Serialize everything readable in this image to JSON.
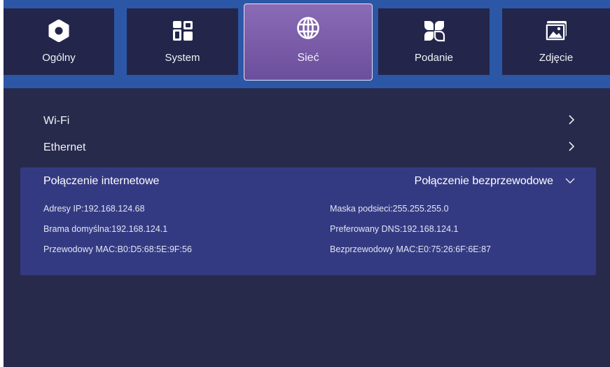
{
  "tabs": [
    {
      "label": "Ogólny",
      "icon": "gear-icon",
      "active": false
    },
    {
      "label": "System",
      "icon": "grid-apps-icon",
      "active": false
    },
    {
      "label": "Sieć",
      "icon": "globe-icon",
      "active": true
    },
    {
      "label": "Podanie",
      "icon": "clover-apps-icon",
      "active": false
    },
    {
      "label": "Zdjęcie",
      "icon": "picture-icon",
      "active": false
    }
  ],
  "network": {
    "wifi_label": "Wi-Fi",
    "ethernet_label": "Ethernet"
  },
  "connection": {
    "title": "Połączenie internetowe",
    "type_value": "Połączenie bezprzewodowe",
    "ip": "Adresy IP:192.168.124.68",
    "subnet": "Maska podsieci:255.255.255.0",
    "gateway": "Brama domyślna:192.168.124.1",
    "dns": "Preferowany DNS:192.168.124.1",
    "wired_mac": "Przewodowy MAC:B0:D5:68:5E:9F:56",
    "wireless_mac": "Bezprzewodowy MAC:E0:75:26:6F:6E:87"
  },
  "colors": {
    "background": "#282a4b",
    "top_band": "#2c57a6",
    "tab": "#23264a",
    "active_tab": "#7a5cab",
    "panel": "#343a82"
  }
}
